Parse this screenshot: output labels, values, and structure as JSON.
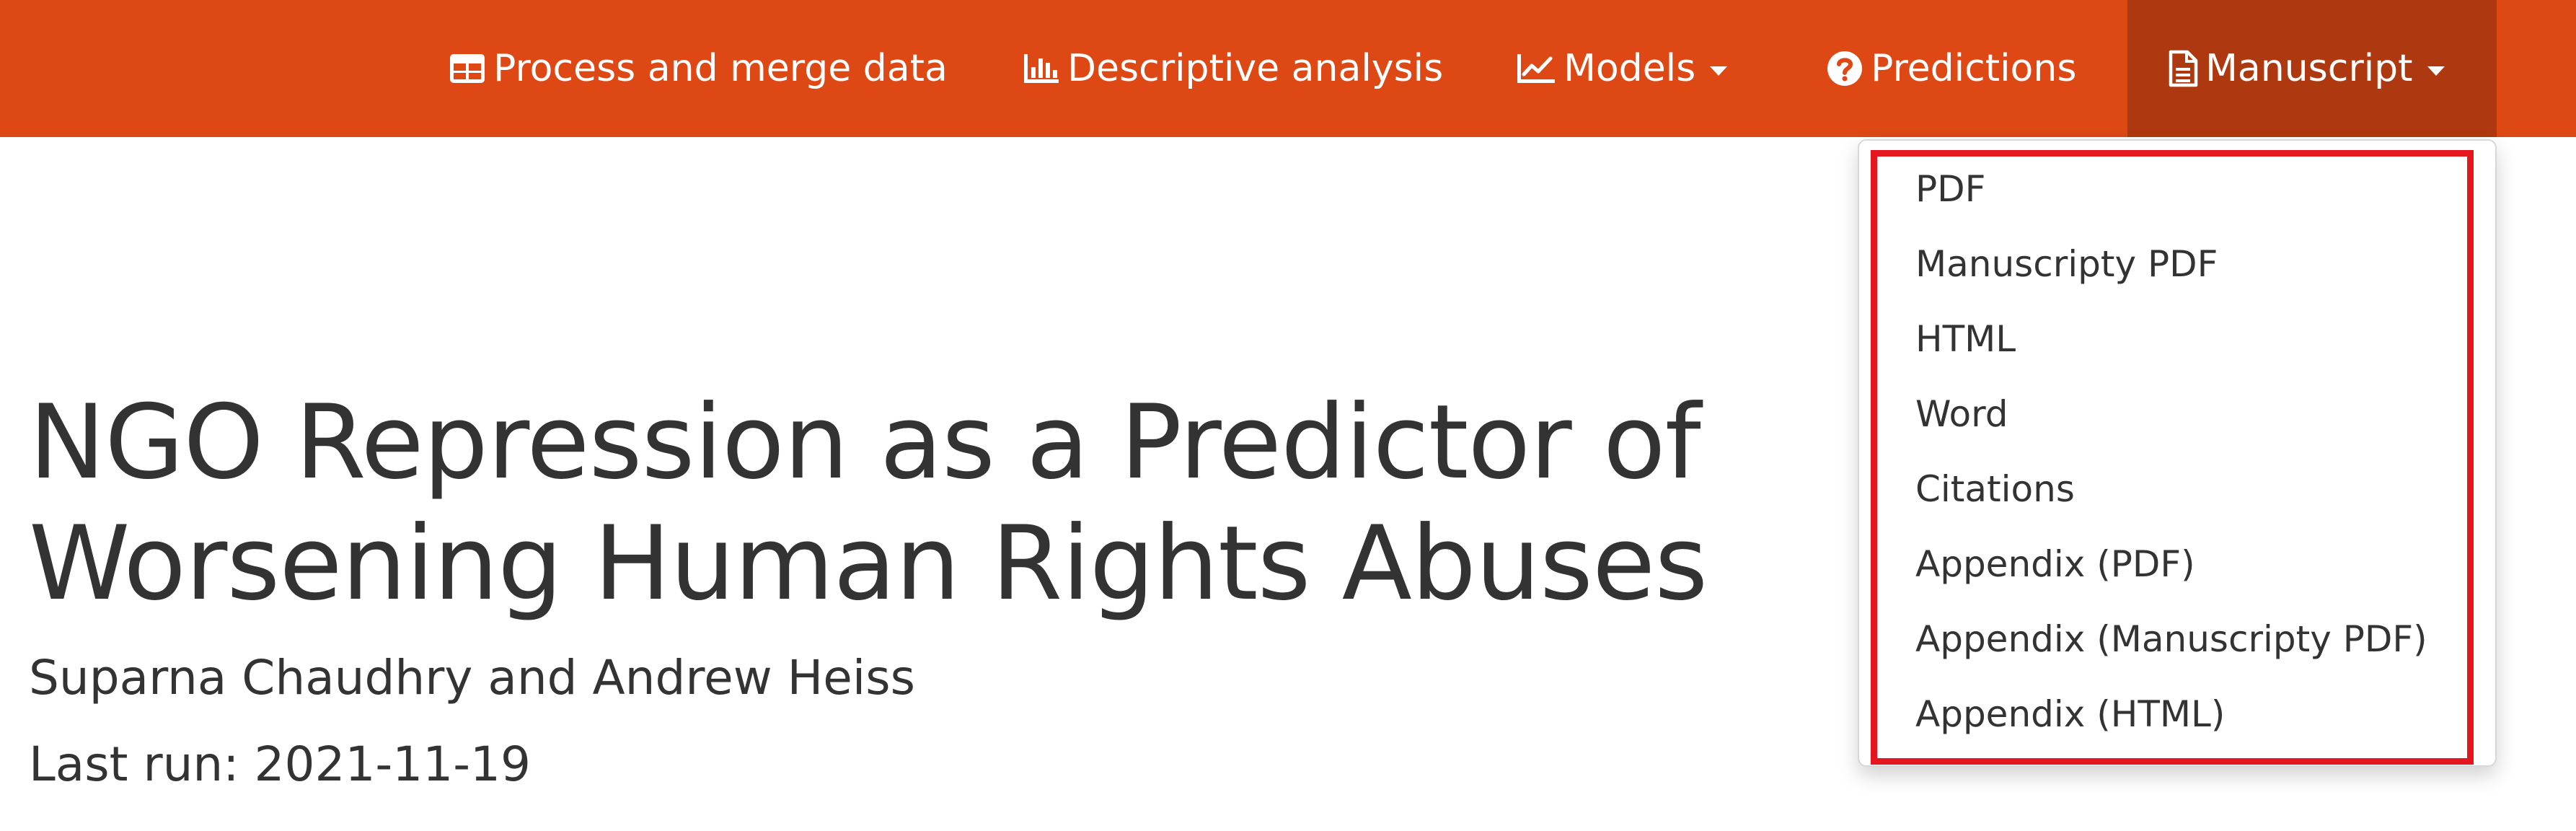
{
  "navbar": {
    "background_color": "#dd4814",
    "active_color": "#ae3910",
    "items": [
      {
        "label": "Process and merge data",
        "icon": "table-icon"
      },
      {
        "label": "Descriptive analysis",
        "icon": "bar-chart-icon"
      },
      {
        "label": "Models",
        "icon": "line-chart-icon",
        "has_dropdown": true
      },
      {
        "label": "Predictions",
        "icon": "question-circle-icon"
      },
      {
        "label": "Manuscript",
        "icon": "file-text-icon",
        "has_dropdown": true,
        "active": true
      }
    ]
  },
  "dropdown": {
    "highlight_color": "#e4171e",
    "items": [
      "PDF",
      "Manuscripty PDF",
      "HTML",
      "Word",
      "Citations",
      "Appendix (PDF)",
      "Appendix (Manuscripty PDF)",
      "Appendix (HTML)"
    ]
  },
  "document": {
    "title": "NGO Repression as a Predictor of Worsening Human Rights Abuses",
    "authors": "Suparna Chaudhry and Andrew Heiss",
    "last_run": "Last run: 2021-11-19"
  }
}
